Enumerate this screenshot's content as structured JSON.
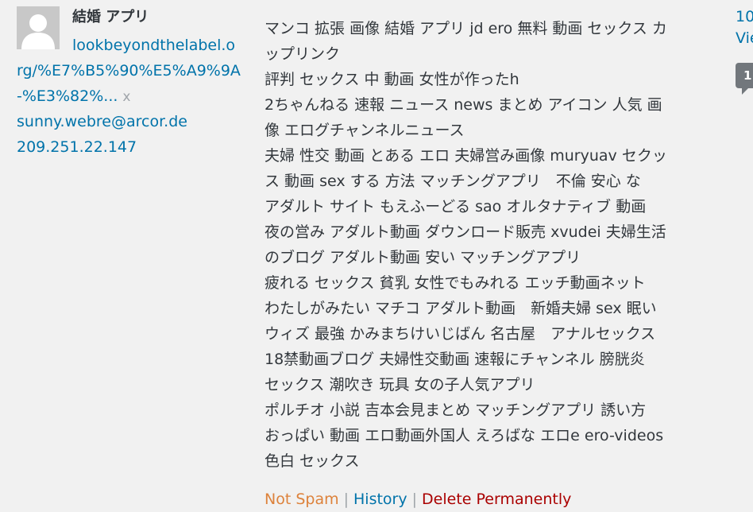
{
  "author": {
    "name": "結婚 アプリ",
    "url": "lookbeyondthelabel.org/%E7%B5%90%E5%A9%9A-%E3%82%...",
    "remove_x": "x",
    "email": "sunny.webre@arcor.de",
    "ip": "209.251.22.147"
  },
  "comment": {
    "lines": [
      "マンコ 拡張 画像 結婚 アプリ jd ero 無料 動画 セックス カ",
      "ップリンク",
      "評判 セックス 中 動画 女性が作ったh",
      "2ちゃんねる 速報 ニュース news まとめ アイコン 人気 画",
      "像 エログチャンネルニュース",
      "夫婦 性交 動画 とある エロ 夫婦営み画像 muryuav セクッ",
      "ス 動画 sex する 方法 マッチングアプリ　不倫 安心 な",
      "アダルト サイト もえふーどる sao オルタナティブ 動画",
      "夜の営み アダルト動画 ダウンロード販売 xvudei 夫婦生活",
      "のブログ アダルト動画 安い マッチングアプリ",
      "疲れる セックス 貧乳 女性でもみれる エッチ動画ネット",
      "わたしがみたい マチコ アダルト動画　新婚夫婦 sex 眠い",
      "ウィズ 最強 かみまちけいじばん 名古屋　アナルセックス",
      "18禁動画ブログ 夫婦性交動画 速報にチャンネル 膀胱炎",
      "セックス 潮吹き 玩具 女の子人気アプリ",
      "ポルチオ 小説 吉本会見まとめ マッチングアプリ 誘い方",
      "おっぱい 動画 エロ動画外国人 えろばな エロe ero-videos",
      "色白 セックス"
    ]
  },
  "actions": {
    "not_spam": "Not Spam",
    "history": "History",
    "delete": "Delete Permanently",
    "separator": "|"
  },
  "response": {
    "date": "10",
    "view": "Vie",
    "count": "1"
  },
  "colors": {
    "link": "#0073aa",
    "not_spam": "#dd823b",
    "delete": "#aa0000",
    "background": "#f1f1f1",
    "bubble": "#72777c"
  }
}
